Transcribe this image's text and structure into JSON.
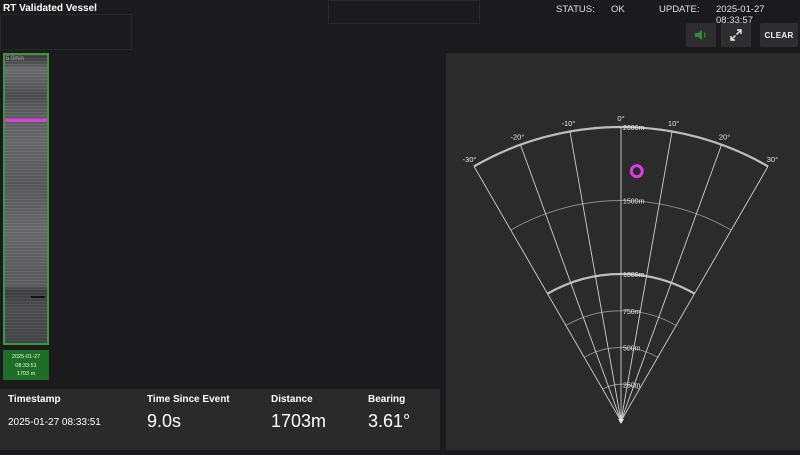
{
  "header": {
    "title": "RT Validated Vessel",
    "status_label": "STATUS:",
    "status_value": "OK",
    "update_label": "UPDATE:",
    "update_value": "2025-01-27 08:33:57"
  },
  "toolbar": {
    "sound_icon": "speaker-icon",
    "expand_icon": "expand-icon",
    "clear_label": "CLEAR",
    "accent": "#2e8b3a"
  },
  "waterfall": {
    "caption": "5.0min",
    "event_marker_color": "#e13ae1",
    "event_card": {
      "date": "2025-01-27",
      "time": "08:33:51",
      "distance": "1703 m"
    }
  },
  "event_info": {
    "columns": [
      {
        "header": "Timestamp",
        "value": "2025-01-27 08:33:51"
      },
      {
        "header": "Time Since Event",
        "value": "9.0s"
      },
      {
        "header": "Distance",
        "value": "1703m"
      },
      {
        "header": "Bearing",
        "value": "3.61°"
      }
    ]
  },
  "radar": {
    "bearing_labels": [
      "-30°",
      "-20°",
      "-10°",
      "0°",
      "10°",
      "20°",
      "30°"
    ],
    "bearings": [
      -30,
      -20,
      -10,
      0,
      10,
      20,
      30
    ],
    "range_labels": [
      "2000m",
      "1500m",
      "1000m",
      "750m",
      "500m",
      "250m"
    ],
    "ranges": [
      2000,
      1500,
      1000,
      750,
      500,
      250
    ],
    "max_range": 2000,
    "target": {
      "distance": 1703,
      "bearing": 3.61,
      "color": "#e13ae1"
    }
  }
}
